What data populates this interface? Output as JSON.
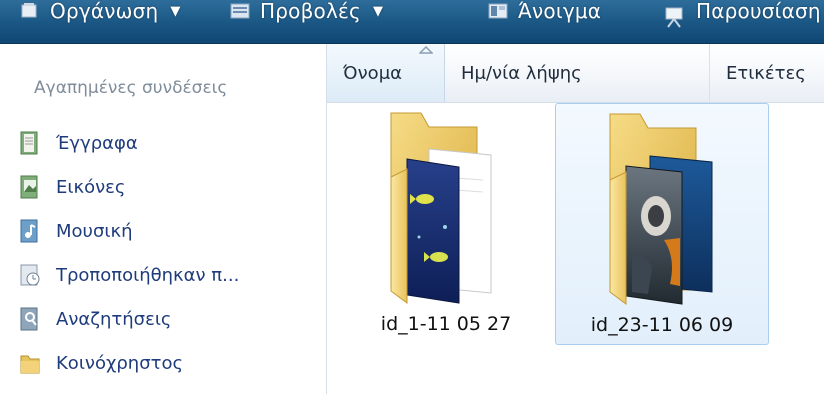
{
  "toolbar": {
    "items": [
      {
        "label": "Οργάνωση",
        "icon": "organize-icon",
        "has_dropdown": true
      },
      {
        "label": "Προβολές",
        "icon": "views-icon",
        "has_dropdown": true
      },
      {
        "label": "Άνοιγμα",
        "icon": "open-icon",
        "has_dropdown": false
      },
      {
        "label": "Παρουσίαση",
        "icon": "slideshow-icon",
        "has_dropdown": false
      }
    ],
    "dropdown_glyph": "▼"
  },
  "nav": {
    "title": "Αγαπημένες συνδέσεις",
    "items": [
      {
        "label": "Έγγραφα",
        "icon": "documents-icon"
      },
      {
        "label": "Εικόνες",
        "icon": "pictures-icon"
      },
      {
        "label": "Μουσική",
        "icon": "music-icon"
      },
      {
        "label": "Τροποποιήθηκαν π...",
        "icon": "recently-changed-icon"
      },
      {
        "label": "Αναζητήσεις",
        "icon": "searches-icon"
      },
      {
        "label": "Κοινόχρηστος",
        "icon": "public-folder-icon"
      }
    ]
  },
  "columns": {
    "name": "Όνομα",
    "date": "Ημ/νία λήψης",
    "tags": "Ετικέτες",
    "sorted_by": "name"
  },
  "files": [
    {
      "name": "id_1-11 05 27",
      "selected": false,
      "icon": "folder-fish-preview-icon"
    },
    {
      "name": "id_23-11 06 09",
      "selected": true,
      "icon": "folder-photo-preview-icon"
    }
  ],
  "colors": {
    "toolbar_top": "#2e6d9b",
    "toolbar_bottom": "#0f4673",
    "nav_link": "#1e3b7b",
    "nav_title": "#7f8c99",
    "selection_border": "#a9cff0",
    "selection_fill": "#e2effb"
  }
}
